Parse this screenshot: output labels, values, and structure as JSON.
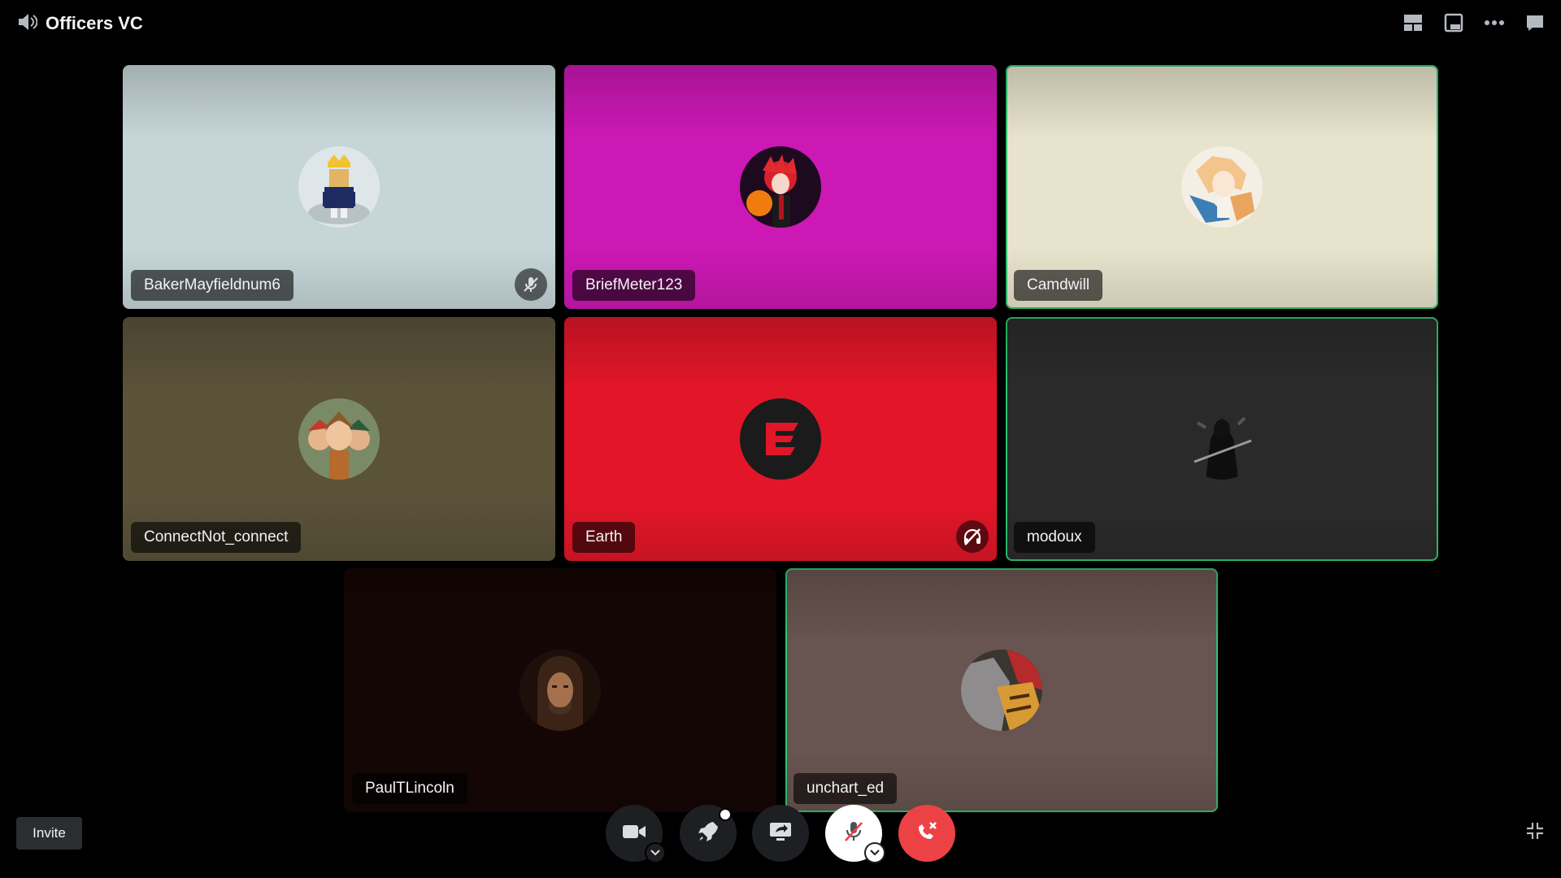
{
  "header": {
    "channel_name": "Officers VC",
    "channel_icon": "speaker-icon",
    "actions": [
      "grid-layout-icon",
      "popout-icon",
      "more-icon",
      "chat-icon"
    ]
  },
  "participants": [
    {
      "name": "BakerMayfieldnum6",
      "tile_color": "#c6d6d8",
      "status": "muted",
      "speaking": false
    },
    {
      "name": "BriefMeter123",
      "tile_color": "#cc18b4",
      "status": "",
      "speaking": false
    },
    {
      "name": "Camdwill",
      "tile_color": "#e7e3cc",
      "status": "",
      "speaking": true
    },
    {
      "name": "ConnectNot_connect",
      "tile_color": "#5a5239",
      "status": "",
      "speaking": false
    },
    {
      "name": "Earth",
      "tile_color": "#e21628",
      "status": "deafened",
      "speaking": false
    },
    {
      "name": "modoux",
      "tile_color": "#2b2b2b",
      "status": "",
      "speaking": true
    },
    {
      "name": "PaulTLincoln",
      "tile_color": "#140605",
      "status": "",
      "speaking": false
    },
    {
      "name": "unchart_ed",
      "tile_color": "#685450",
      "status": "",
      "speaking": true
    }
  ],
  "footer": {
    "invite_label": "Invite",
    "controls": [
      "camera-icon",
      "activity-rocket-icon",
      "share-screen-icon",
      "microphone-muted-icon",
      "disconnect-icon"
    ],
    "collapse_icon": "collapse-icon"
  },
  "colors": {
    "background": "#000000",
    "speaking_ring": "#2dc770",
    "disconnect": "#ed4245",
    "button_dark": "#1e1f22"
  }
}
